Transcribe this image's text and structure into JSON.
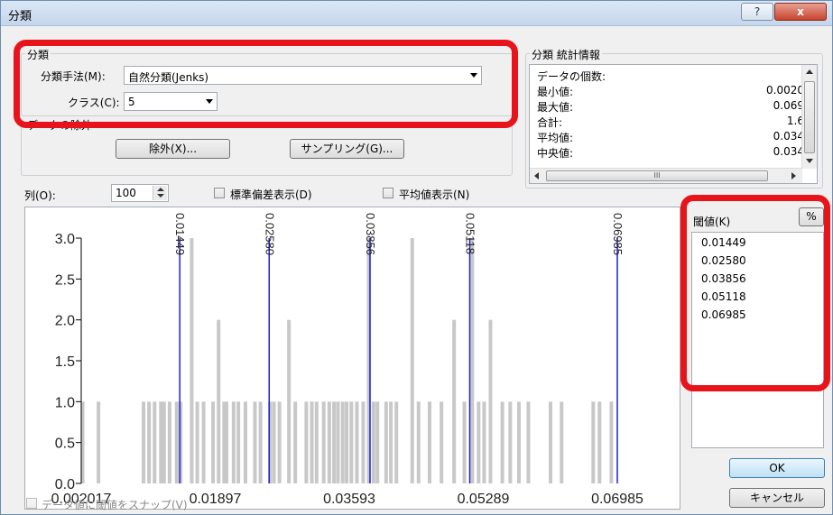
{
  "window": {
    "title": "分類",
    "help_label": "?",
    "close_label": "x"
  },
  "classification": {
    "group_label": "分類",
    "method_label": "分類手法(M):",
    "method_value": "自然分類(Jenks)",
    "class_label": "クラス(C):",
    "class_value": "5"
  },
  "exclusion": {
    "group_label": "データの除外",
    "exclude_button": "除外(X)...",
    "sampling_button": "サンプリング(G)..."
  },
  "stats": {
    "group_label": "分類 統計情報",
    "rows": [
      {
        "key": "データの個数:",
        "value": ""
      },
      {
        "key": "最小値:",
        "value": "0.0020"
      },
      {
        "key": "最大値:",
        "value": "0.069"
      },
      {
        "key": "合計:",
        "value": "1.6"
      },
      {
        "key": "平均値:",
        "value": "0.034"
      },
      {
        "key": "中央値:",
        "value": "0.034"
      }
    ],
    "hscroll_grip": "III"
  },
  "columns": {
    "label": "列(O):",
    "value": "100",
    "show_std_label": "標準偏差表示(D)",
    "show_mean_label": "平均値表示(N)"
  },
  "breaks_panel": {
    "label": "閾値(K)",
    "percent_button": "%",
    "values": [
      "0.01449",
      "0.02580",
      "0.03856",
      "0.05118",
      "0.06985"
    ]
  },
  "buttons": {
    "ok": "OK",
    "cancel": "キャンセル"
  },
  "snap": {
    "label": "データ値に閾値をスナップ(V)"
  },
  "colors": {
    "highlight": "#e8141b",
    "bars": "#c8c8c8",
    "break_line": "#1f1fd6"
  },
  "chart_data": {
    "type": "bar",
    "title": "",
    "xlabel": "",
    "ylabel": "",
    "ylim": [
      0,
      3
    ],
    "xlim": [
      0.002017,
      0.06985
    ],
    "y_ticks": [
      "3.0",
      "2.5",
      "2.0",
      "1.5",
      "1.0",
      "0.5",
      "0.0"
    ],
    "x_ticks": [
      "0.002017",
      "0.01897",
      "0.03593",
      "0.05289",
      "0.06985"
    ],
    "break_lines": [
      {
        "x": 0.01449,
        "label": "0.01449"
      },
      {
        "x": 0.0258,
        "label": "0.02580"
      },
      {
        "x": 0.03856,
        "label": "0.03856"
      },
      {
        "x": 0.05118,
        "label": "0.05118"
      },
      {
        "x": 0.06985,
        "label": "0.06985"
      }
    ],
    "bars": [
      {
        "x": 0.0022,
        "y": 1
      },
      {
        "x": 0.0042,
        "y": 1
      },
      {
        "x": 0.0099,
        "y": 1
      },
      {
        "x": 0.0106,
        "y": 1
      },
      {
        "x": 0.0113,
        "y": 1
      },
      {
        "x": 0.0121,
        "y": 1
      },
      {
        "x": 0.0125,
        "y": 1
      },
      {
        "x": 0.0132,
        "y": 1
      },
      {
        "x": 0.0141,
        "y": 1
      },
      {
        "x": 0.0146,
        "y": 1
      },
      {
        "x": 0.016,
        "y": 3
      },
      {
        "x": 0.0167,
        "y": 1
      },
      {
        "x": 0.0175,
        "y": 1
      },
      {
        "x": 0.0187,
        "y": 1
      },
      {
        "x": 0.0194,
        "y": 2
      },
      {
        "x": 0.0201,
        "y": 1
      },
      {
        "x": 0.0204,
        "y": 1
      },
      {
        "x": 0.0213,
        "y": 1
      },
      {
        "x": 0.0219,
        "y": 1
      },
      {
        "x": 0.0228,
        "y": 1
      },
      {
        "x": 0.024,
        "y": 1
      },
      {
        "x": 0.0247,
        "y": 1
      },
      {
        "x": 0.0259,
        "y": 1
      },
      {
        "x": 0.0264,
        "y": 1
      },
      {
        "x": 0.0271,
        "y": 1
      },
      {
        "x": 0.0283,
        "y": 2
      },
      {
        "x": 0.0291,
        "y": 1
      },
      {
        "x": 0.0305,
        "y": 1
      },
      {
        "x": 0.0312,
        "y": 1
      },
      {
        "x": 0.0318,
        "y": 1
      },
      {
        "x": 0.0327,
        "y": 1
      },
      {
        "x": 0.0334,
        "y": 1
      },
      {
        "x": 0.034,
        "y": 1
      },
      {
        "x": 0.0345,
        "y": 1
      },
      {
        "x": 0.0351,
        "y": 1
      },
      {
        "x": 0.0356,
        "y": 1
      },
      {
        "x": 0.0362,
        "y": 1
      },
      {
        "x": 0.0369,
        "y": 1
      },
      {
        "x": 0.0377,
        "y": 1
      },
      {
        "x": 0.0384,
        "y": 3
      },
      {
        "x": 0.039,
        "y": 1
      },
      {
        "x": 0.0395,
        "y": 1
      },
      {
        "x": 0.0406,
        "y": 1
      },
      {
        "x": 0.0412,
        "y": 1
      },
      {
        "x": 0.0419,
        "y": 1
      },
      {
        "x": 0.0439,
        "y": 3
      },
      {
        "x": 0.0447,
        "y": 1
      },
      {
        "x": 0.0461,
        "y": 1
      },
      {
        "x": 0.0476,
        "y": 1
      },
      {
        "x": 0.0492,
        "y": 2
      },
      {
        "x": 0.0505,
        "y": 1
      },
      {
        "x": 0.0515,
        "y": 3
      },
      {
        "x": 0.0523,
        "y": 1
      },
      {
        "x": 0.053,
        "y": 1
      },
      {
        "x": 0.0538,
        "y": 2
      },
      {
        "x": 0.0553,
        "y": 1
      },
      {
        "x": 0.0563,
        "y": 1
      },
      {
        "x": 0.0574,
        "y": 1
      },
      {
        "x": 0.0586,
        "y": 1
      },
      {
        "x": 0.0614,
        "y": 1
      },
      {
        "x": 0.0628,
        "y": 1
      },
      {
        "x": 0.0668,
        "y": 1
      },
      {
        "x": 0.0676,
        "y": 1
      },
      {
        "x": 0.0691,
        "y": 1
      }
    ]
  }
}
